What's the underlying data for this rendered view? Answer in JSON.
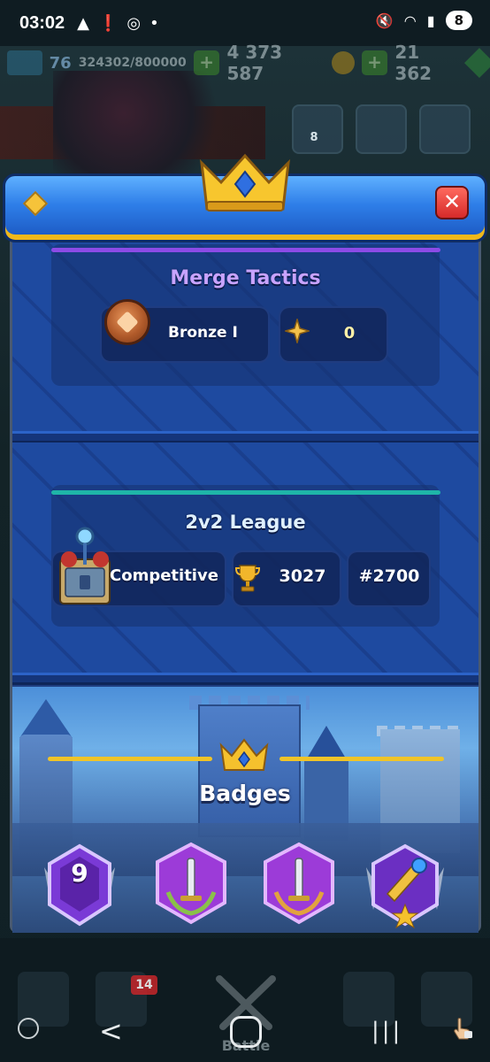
{
  "status_bar": {
    "time": "03:02",
    "battery": "8",
    "left_icons": [
      "warning-icon",
      "alert-icon",
      "instagram-icon",
      "dot-icon"
    ],
    "right_icons": [
      "mute-icon",
      "wifi-icon",
      "signal-icon"
    ]
  },
  "top_bar": {
    "level": "76",
    "xp": "324302/800000",
    "gold": "4 373 587",
    "gems": "21 362"
  },
  "friends_count": "8",
  "merge_tactics": {
    "title": "Merge Tactics",
    "rank_label": "Bronze I",
    "points": "0"
  },
  "league": {
    "title": "2v2 League",
    "mode_label": "Competitive",
    "trophies": "3027",
    "rank": "#2700"
  },
  "badges": {
    "title": "Badges",
    "first_badge_number": "9"
  },
  "bottom_nav": {
    "notification_count": "14",
    "battle_label": "Battle"
  },
  "system_nav": {
    "back": "<",
    "recent": "|||"
  },
  "colors": {
    "panel_blue": "#1d469a",
    "header_blue": "#2e7ee8",
    "gold": "#f0c428",
    "merge_purple": "#8c4be6",
    "league_teal": "#1fb5a8",
    "close_red": "#d52a2a"
  }
}
